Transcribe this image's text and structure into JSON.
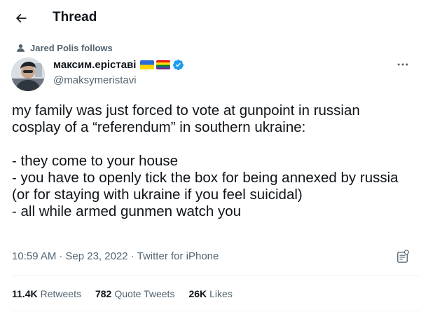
{
  "header": {
    "title": "Thread",
    "back_icon": "arrow-left-icon"
  },
  "social_context": {
    "text": "Jared Polis follows",
    "icon": "person-icon"
  },
  "author": {
    "display_name": "максим.ерістaві",
    "handle": "@maksymeristavi",
    "flags": [
      "ukraine-flag",
      "rainbow-flag"
    ],
    "verified": true
  },
  "tweet": {
    "text": "my family was just forced to vote at gunpoint in russian cosplay of a “referendum” in southern ukraine:\n\n- they come to your house\n- you have to openly tick the box for being annexed by russia (or for staying with ukraine if you feel suicidal)\n- all while armed gunmen watch you",
    "time": "10:59 AM",
    "date": "Sep 23, 2022",
    "source": "Twitter for iPhone"
  },
  "stats": {
    "retweets": {
      "count": "11.4K",
      "label": "Retweets"
    },
    "quote_tweets": {
      "count": "782",
      "label": "Quote Tweets"
    },
    "likes": {
      "count": "26K",
      "label": "Likes"
    }
  },
  "colors": {
    "secondary": "#536471",
    "primary_text": "#0f1419",
    "accent": "#1d9bf0",
    "divider": "#eff3f4"
  }
}
